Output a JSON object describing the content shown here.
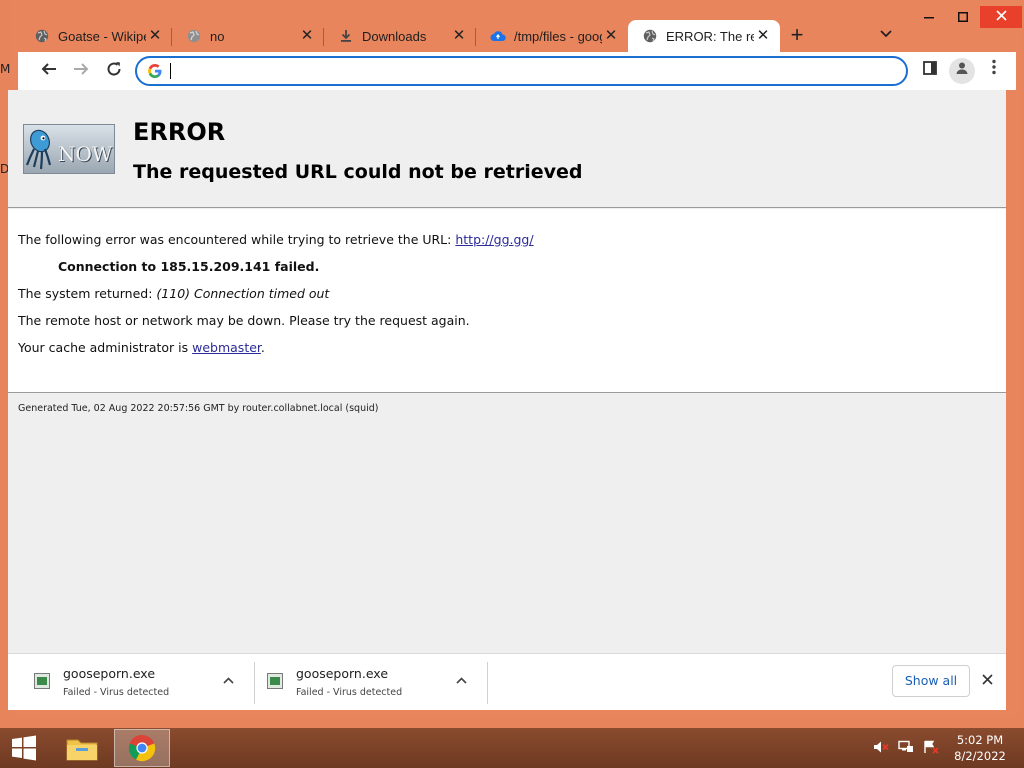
{
  "desktop": {
    "edge_glyph_top": "M",
    "edge_glyph_bottom": "D"
  },
  "browser": {
    "tabs": [
      {
        "title": "Goatse - Wikipedia",
        "icon": "globe-icon",
        "active": false
      },
      {
        "title": "no",
        "icon": "globe-icon",
        "active": false
      },
      {
        "title": "Downloads",
        "icon": "download-icon",
        "active": false
      },
      {
        "title": "/tmp/files - google",
        "icon": "cloud-drive-icon",
        "active": false
      },
      {
        "title": "ERROR: The requested URL could not be retrieved",
        "icon": "globe-icon",
        "active": true
      }
    ],
    "new_tab_label": "+",
    "omnibox": {
      "value": "",
      "placeholder": ""
    }
  },
  "error_page": {
    "title": "ERROR",
    "subtitle": "The requested URL could not be retrieved",
    "intro_text": "The following error was encountered while trying to retrieve the URL: ",
    "url_link": "http://gg.gg/",
    "failure_line": "Connection to 185.15.209.141 failed.",
    "system_returned_label": "The system returned: ",
    "system_returned_message": "(110) Connection timed out",
    "remote_host_text": "The remote host or network may be down. Please try the request again.",
    "cache_admin_text": "Your cache administrator is ",
    "cache_admin_link": "webmaster",
    "cache_admin_suffix": ".",
    "generated_text": "Generated Tue, 02 Aug 2022 20:57:56 GMT by router.collabnet.local (squid)",
    "logo_text": "NOW"
  },
  "download_bar": {
    "items": [
      {
        "name": "gooseporn.exe",
        "status": "Failed - Virus detected"
      },
      {
        "name": "gooseporn.exe",
        "status": "Failed - Virus detected"
      }
    ],
    "show_all_label": "Show all"
  },
  "taskbar": {
    "time": "5:02 PM",
    "date": "8/2/2022"
  },
  "colors": {
    "frame": "#e9855c",
    "omnibox_border": "#1a6fd1",
    "link": "#2b2b9a",
    "close_button": "#e8402a"
  }
}
